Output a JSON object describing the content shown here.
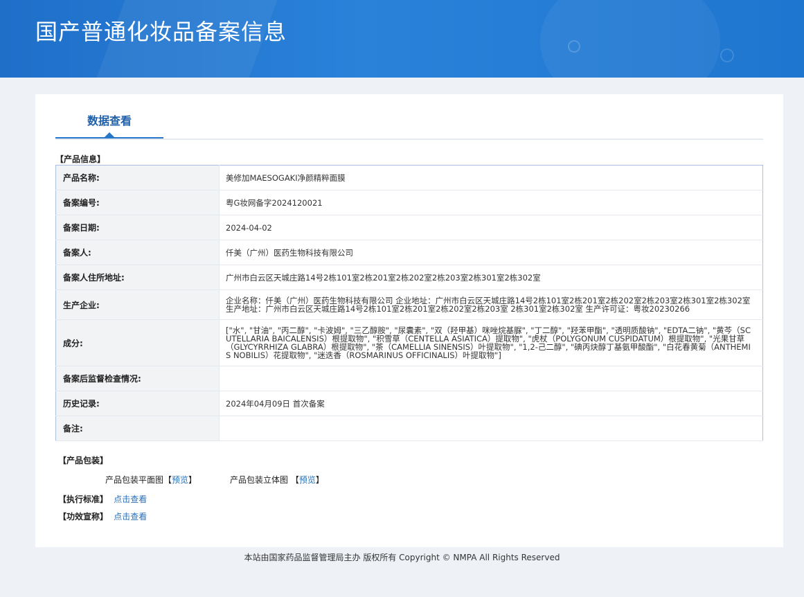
{
  "header": {
    "title": "国产普通化妆品备案信息"
  },
  "tabs": [
    {
      "label": "数据查看"
    }
  ],
  "product_section": {
    "heading": "【产品信息】",
    "rows": [
      {
        "label": "产品名称:",
        "value": "美修加MAESOGAKI净颜精粹面膜"
      },
      {
        "label": "备案编号:",
        "value": "粤G妆网备字2024120021"
      },
      {
        "label": "备案日期:",
        "value": "2024-04-02"
      },
      {
        "label": "备案人:",
        "value": "仟美（广州）医药生物科技有限公司"
      },
      {
        "label": "备案人住所地址:",
        "value": "广州市白云区天城庄路14号2栋101室2栋201室2栋202室2栋203室2栋301室2栋302室"
      },
      {
        "label": "生产企业:",
        "value": "企业名称：仟美（广州）医药生物科技有限公司 企业地址：广州市白云区天城庄路14号2栋101室2栋201室2栋202室2栋203室2栋301室2栋302室 生产地址：广州市白云区天城庄路14号2栋101室2栋201室2栋202室2栋203室 2栋301室2栋302室 生产许可证：粤妆20230266"
      },
      {
        "label": "成分:",
        "value": "[\"水\", \"甘油\", \"丙二醇\", \"卡波姆\", \"三乙醇胺\", \"尿囊素\", \"双（羟甲基）咪唑烷基脲\", \"丁二醇\", \"羟苯甲酯\", \"透明质酸钠\", \"EDTA二钠\", \"黄芩（SCUTELLARIA BAICALENSIS）根提取物\", \"积雪草（CENTELLA ASIATICA）提取物\", \"虎杖（POLYGONUM CUSPIDATUM）根提取物\", \"光果甘草（GLYCYRRHIZA GLABRA）根提取物\", \"茶（CAMELLIA SINENSIS）叶提取物\", \"1,2-己二醇\", \"碘丙炔醇丁基氨甲酸酯\", \"白花春黄菊（ANTHEMIS NOBILIS）花提取物\", \"迷迭香（ROSMARINUS OFFICINALIS）叶提取物\"]"
      },
      {
        "label": "备案后监督检查情况:",
        "value": ""
      },
      {
        "label": "历史记录:",
        "value": "2024年04月09日 首次备案"
      },
      {
        "label": "备注:",
        "value": ""
      }
    ]
  },
  "packaging": {
    "heading": "【产品包装】",
    "items": [
      {
        "label": "产品包装平面图",
        "link": "预览"
      },
      {
        "label": "产品包装立体图 ",
        "link": "预览"
      }
    ]
  },
  "standard": {
    "heading": "【执行标准】",
    "link": "点击查看"
  },
  "efficacy": {
    "heading": "【功效宣称】",
    "link": "点击查看"
  },
  "footer": {
    "text": "本站由国家药品监督管理局主办 版权所有 Copyright © NMPA All Rights Reserved"
  }
}
